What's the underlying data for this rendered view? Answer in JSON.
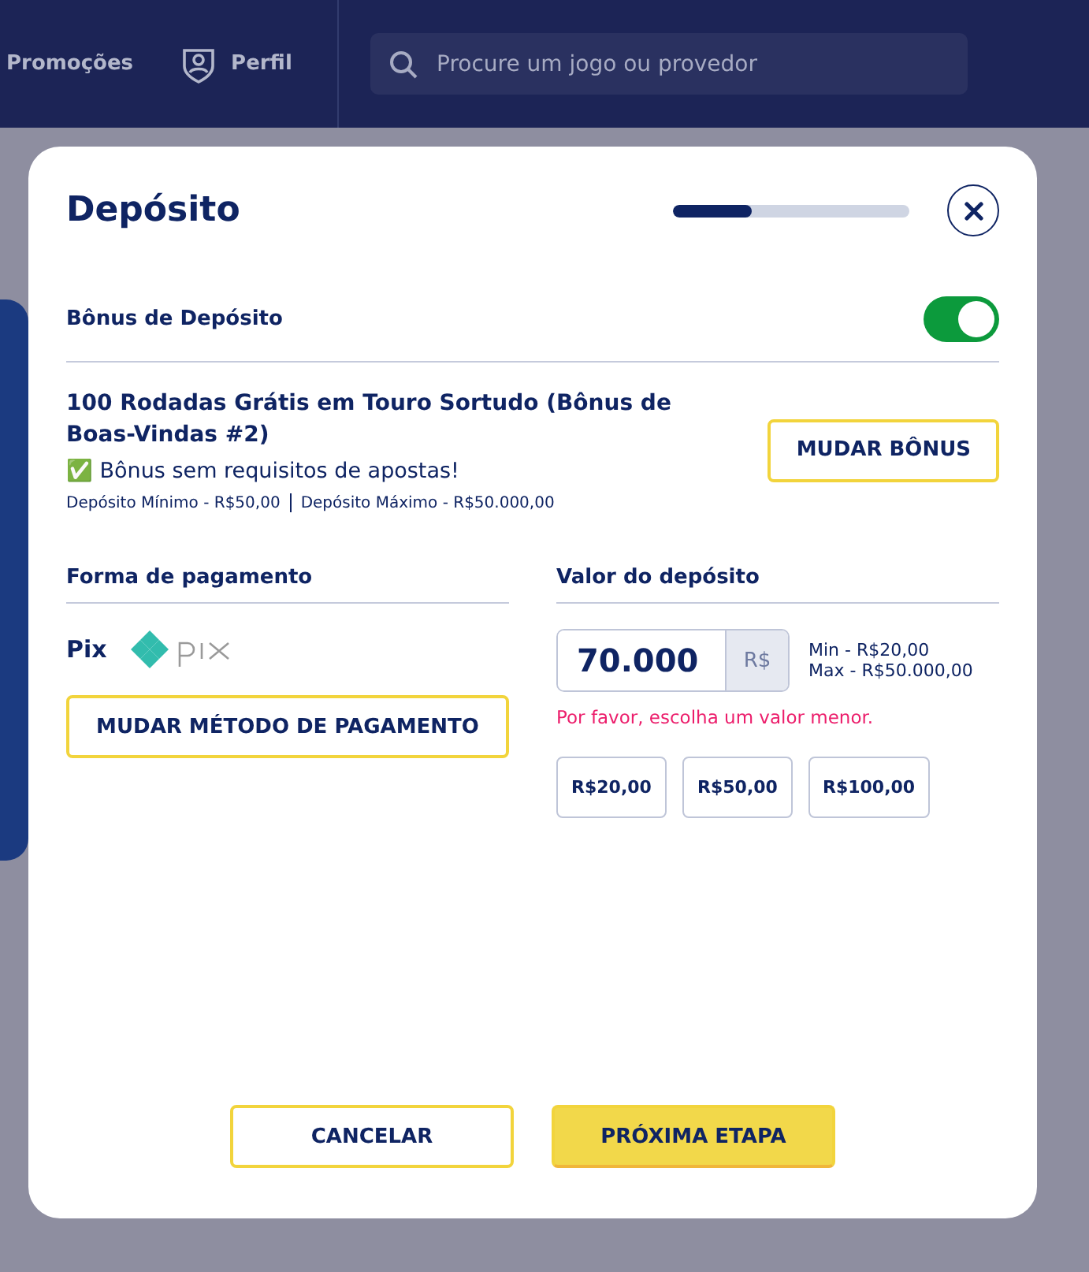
{
  "header": {
    "nav": [
      {
        "label": "Promoções"
      },
      {
        "label": "Perfil"
      }
    ],
    "search": {
      "placeholder": "Procure um jogo ou provedor"
    }
  },
  "modal": {
    "title": "Depósito",
    "progress": {
      "level": 0.33
    },
    "bonus_toggle": {
      "label": "Bônus de Depósito",
      "on": true
    },
    "bonus": {
      "name": "100 Rodadas Grátis em Touro Sortudo (Bônus de Boas-Vindas #2)",
      "note": "✅ Bônus sem requisitos de apostas!",
      "limits": [
        "Depósito Mínimo - R$50,00",
        "Depósito Máximo - R$50.000,00"
      ],
      "button": "MUDAR BÔNUS"
    },
    "payment": {
      "heading": "Forma de pagamento",
      "method": "Pix",
      "button": "MUDAR MÉTODO DE PAGAMENTO"
    },
    "amount": {
      "heading": "Valor do depósito",
      "value": "70.000",
      "currency": "R$",
      "min": "Min - R$20,00",
      "max": "Max - R$50.000,00",
      "error": "Por favor, escolha um valor menor.",
      "presets": [
        "R$20,00",
        "R$50,00",
        "R$100,00"
      ]
    },
    "buttons": [
      {
        "label": "CANCELAR",
        "kind": "secondary"
      },
      {
        "label": "PRÓXIMA ETAPA",
        "kind": "primary"
      }
    ]
  }
}
